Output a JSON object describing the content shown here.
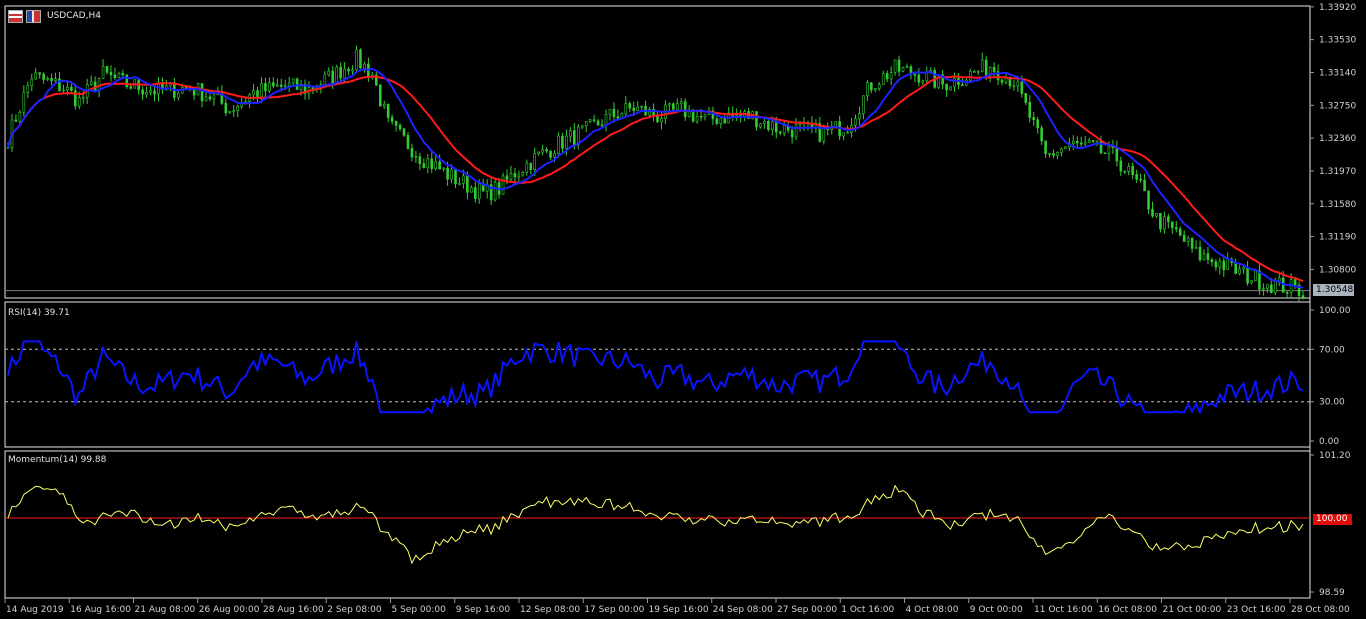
{
  "window": {
    "symbol_label": "USDCAD,H4"
  },
  "main_chart": {
    "price_axis": [
      "1.33920",
      "1.33530",
      "1.33140",
      "1.32750",
      "1.32360",
      "1.31970",
      "1.31580",
      "1.31190",
      "1.30800"
    ],
    "current_price": "1.30548",
    "ylim": [
      1.3046,
      1.3393
    ],
    "colors": {
      "bull": "#32cd32",
      "bear": "#32cd32",
      "ma_fast": "#1e22ff",
      "ma_slow": "#ff1b1b",
      "bid_line": "#808080"
    }
  },
  "rsi_panel": {
    "label": "RSI(14) 39.71",
    "axis": [
      "100.00",
      "70.00",
      "30.00",
      "0.00"
    ],
    "levels": [
      70,
      30
    ],
    "color": "#0a14ff"
  },
  "momentum_panel": {
    "label": "Momentum(14) 99.88",
    "axis": [
      "101.20",
      "98.59"
    ],
    "current": "100.00",
    "ylim": [
      98.59,
      101.2
    ],
    "color": "#ffff66",
    "level_color": "#ff1b1b"
  },
  "time_axis": [
    "14 Aug 2019",
    "16 Aug 16:00",
    "21 Aug 08:00",
    "26 Aug 00:00",
    "28 Aug 16:00",
    "2 Sep 08:00",
    "5 Sep 00:00",
    "9 Sep 16:00",
    "12 Sep 08:00",
    "17 Sep 00:00",
    "19 Sep 16:00",
    "24 Sep 08:00",
    "27 Sep 00:00",
    "1 Oct 16:00",
    "4 Oct 08:00",
    "9 Oct 00:00",
    "11 Oct 16:00",
    "16 Oct 08:00",
    "21 Oct 00:00",
    "23 Oct 16:00",
    "28 Oct 08:00"
  ],
  "chart_data": {
    "type": "candlestick",
    "close_keypoints": [
      [
        0,
        1.3236
      ],
      [
        6,
        1.331
      ],
      [
        14,
        1.3296
      ],
      [
        18,
        1.328
      ],
      [
        24,
        1.3312
      ],
      [
        30,
        1.33
      ],
      [
        38,
        1.3292
      ],
      [
        46,
        1.3296
      ],
      [
        52,
        1.3284
      ],
      [
        56,
        1.327
      ],
      [
        62,
        1.329
      ],
      [
        70,
        1.3298
      ],
      [
        76,
        1.3294
      ],
      [
        82,
        1.331
      ],
      [
        88,
        1.333
      ],
      [
        92,
        1.3312
      ],
      [
        96,
        1.3252
      ],
      [
        104,
        1.3215
      ],
      [
        112,
        1.319
      ],
      [
        120,
        1.317
      ],
      [
        124,
        1.3176
      ],
      [
        128,
        1.3195
      ],
      [
        134,
        1.3215
      ],
      [
        140,
        1.3232
      ],
      [
        146,
        1.3245
      ],
      [
        152,
        1.3262
      ],
      [
        158,
        1.3272
      ],
      [
        164,
        1.3262
      ],
      [
        170,
        1.327
      ],
      [
        176,
        1.3258
      ],
      [
        182,
        1.3262
      ],
      [
        188,
        1.3262
      ],
      [
        194,
        1.3248
      ],
      [
        200,
        1.3246
      ],
      [
        206,
        1.3242
      ],
      [
        212,
        1.3252
      ],
      [
        218,
        1.33
      ],
      [
        224,
        1.3318
      ],
      [
        230,
        1.3312
      ],
      [
        236,
        1.33
      ],
      [
        242,
        1.331
      ],
      [
        248,
        1.3322
      ],
      [
        254,
        1.3304
      ],
      [
        258,
        1.3262
      ],
      [
        262,
        1.3214
      ],
      [
        268,
        1.3228
      ],
      [
        274,
        1.3224
      ],
      [
        280,
        1.3212
      ],
      [
        286,
        1.3176
      ],
      [
        290,
        1.314
      ],
      [
        296,
        1.312
      ],
      [
        300,
        1.3098
      ],
      [
        306,
        1.3088
      ],
      [
        312,
        1.3074
      ],
      [
        318,
        1.3064
      ],
      [
        324,
        1.3058
      ],
      [
        327,
        1.3055
      ]
    ],
    "ma_fast": "blue",
    "ma_slow": "red"
  }
}
